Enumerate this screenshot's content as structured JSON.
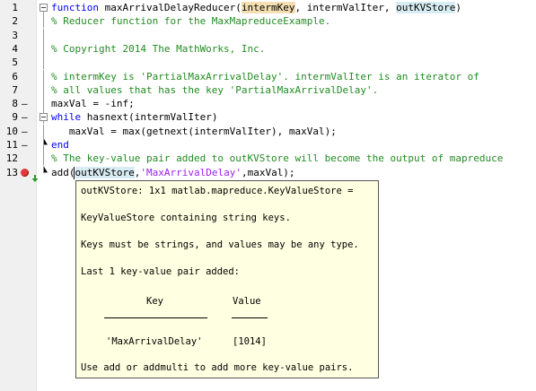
{
  "editor": {
    "lines": [
      {
        "num": "1",
        "dash": "",
        "code": [
          {
            "t": "function ",
            "c": "kw"
          },
          {
            "t": "maxArrivalDelayReducer("
          },
          {
            "t": "intermKey",
            "c": "hlw"
          },
          {
            "t": ", intermValIter, "
          },
          {
            "t": "outKVStore",
            "c": "hl"
          },
          {
            "t": ")"
          }
        ]
      },
      {
        "num": "2",
        "dash": "",
        "code": [
          {
            "t": "% Reducer function for the MaxMapreduceExample.",
            "c": "cm"
          }
        ]
      },
      {
        "num": "3",
        "dash": "",
        "code": []
      },
      {
        "num": "4",
        "dash": "",
        "code": [
          {
            "t": "% Copyright 2014 The MathWorks, Inc.",
            "c": "cm"
          }
        ]
      },
      {
        "num": "5",
        "dash": "",
        "code": []
      },
      {
        "num": "6",
        "dash": "",
        "code": [
          {
            "t": "% intermKey is 'PartialMaxArrivalDelay'. intermValIter is an iterator of",
            "c": "cm"
          }
        ]
      },
      {
        "num": "7",
        "dash": "",
        "code": [
          {
            "t": "% all values that has the key 'PartialMaxArrivalDelay'.",
            "c": "cm"
          }
        ]
      },
      {
        "num": "8",
        "dash": "–",
        "code": [
          {
            "t": "maxVal = -inf;"
          }
        ]
      },
      {
        "num": "9",
        "dash": "–",
        "code": [
          {
            "t": "while ",
            "c": "kw"
          },
          {
            "t": "hasnext(intermValIter)"
          }
        ]
      },
      {
        "num": "10",
        "dash": "–",
        "code": [
          {
            "t": "   maxVal = max(getnext(intermValIter), maxVal);"
          }
        ]
      },
      {
        "num": "11",
        "dash": "–",
        "code": [
          {
            "t": "end",
            "c": "kw"
          }
        ]
      },
      {
        "num": "12",
        "dash": "",
        "code": [
          {
            "t": "% The key-value pair added to outKVStore will become the output of mapreduce",
            "c": "cm"
          }
        ]
      },
      {
        "num": "13",
        "dash": "bp",
        "code": [
          {
            "t": "add("
          },
          {
            "t": "outKVStore",
            "c": "hl"
          },
          {
            "t": ","
          },
          {
            "t": "'MaxArrivalDelay'",
            "c": "str"
          },
          {
            "t": ",maxVal);"
          }
        ]
      }
    ]
  },
  "tooltip": {
    "header": "outKVStore: 1x1 matlab.mapreduce.KeyValueStore =",
    "desc": "KeyValueStore containing string keys.",
    "rule": "Keys must be strings, and values may be any type.",
    "last": "Last 1 key-value pair added:",
    "col_key": "Key",
    "col_value": "Value",
    "row_key": "'MaxArrivalDelay'",
    "row_value": "[1014]",
    "footer": "Use add or addmulti to add more key-value pairs."
  },
  "colors": {
    "keyword": "#0000ff",
    "comment": "#228b22",
    "string": "#a020f0",
    "highlight": "#d8edf3",
    "tooltip_bg": "#ffffe1",
    "breakpoint": "#e03a3a"
  },
  "icons": {
    "breakpoint": "breakpoint-icon",
    "debug_arrow": "debug-arrow-icon",
    "fold": "fold-marker-icon"
  }
}
